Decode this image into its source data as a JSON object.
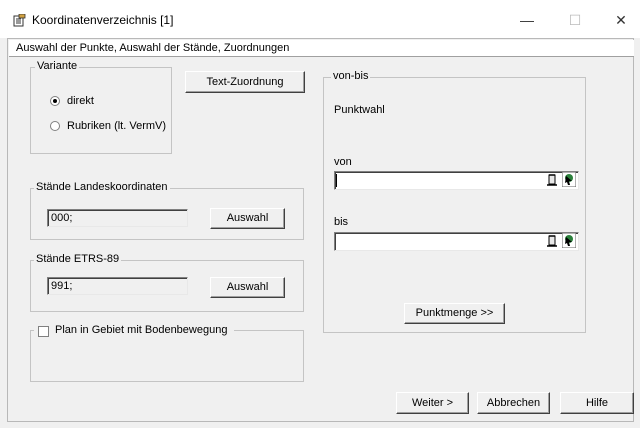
{
  "window": {
    "title": "Koordinatenverzeichnis [1]",
    "minimize": "—",
    "maximize": "☐",
    "close": "✕"
  },
  "tab": {
    "label": "Auswahl der Punkte, Auswahl der Stände, Zuordnungen"
  },
  "variante": {
    "legend": "Variante",
    "option_direkt": "direkt",
    "option_rubriken": "Rubriken (lt. VermV)",
    "selected": "direkt"
  },
  "text_zuordnung_button": "Text-Zuordnung",
  "staende_landes": {
    "legend": "Stände Landeskoordinaten",
    "value": "000;",
    "button": "Auswahl"
  },
  "staende_etrs": {
    "legend": "Stände ETRS-89",
    "value": "991;",
    "button": "Auswahl"
  },
  "plan_gebiet": {
    "label": "Plan in Gebiet mit Bodenbewegung",
    "checked": false
  },
  "von_bis": {
    "legend": "von-bis",
    "punktwahl": "Punktwahl",
    "von_label": "von",
    "von_value": "",
    "bis_label": "bis",
    "bis_value": "",
    "punktmenge_button": "Punktmenge >>"
  },
  "footer": {
    "weiter": "Weiter >",
    "abbrechen": "Abbrechen",
    "hilfe": "Hilfe"
  }
}
